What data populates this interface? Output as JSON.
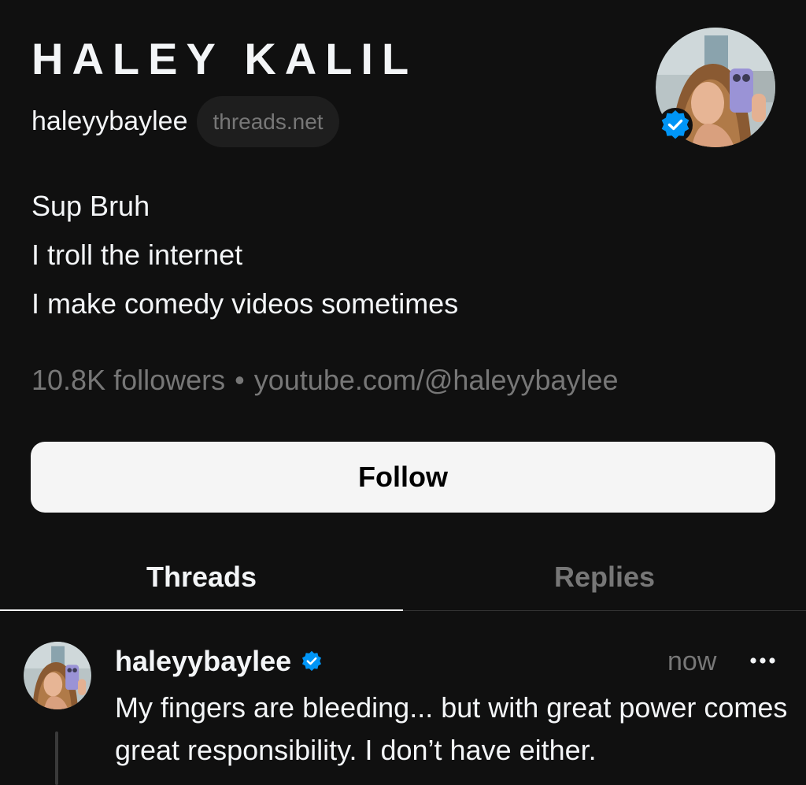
{
  "profile": {
    "display_name": "HALEY KALIL",
    "handle": "haleyybaylee",
    "domain_chip": "threads.net",
    "verified": true,
    "bio_lines": [
      "Sup Bruh",
      "I troll the internet",
      "I make comedy videos sometimes"
    ],
    "followers": "10.8K followers",
    "separator": "•",
    "link": "youtube.com/@haleyybaylee"
  },
  "actions": {
    "follow_label": "Follow"
  },
  "tabs": [
    {
      "label": "Threads",
      "active": true
    },
    {
      "label": "Replies",
      "active": false
    }
  ],
  "post": {
    "username": "haleyybaylee",
    "time": "now",
    "text": "My fingers are bleeding... but with great power comes great responsibility. I don’t have either."
  },
  "colors": {
    "background": "#101010",
    "text_primary": "#f3f5f7",
    "text_secondary": "#777777",
    "verified_blue": "#0095f6",
    "button_bg": "#f5f5f5"
  },
  "icons": {
    "verified": "verified-badge-icon",
    "more": "more-options-icon"
  }
}
